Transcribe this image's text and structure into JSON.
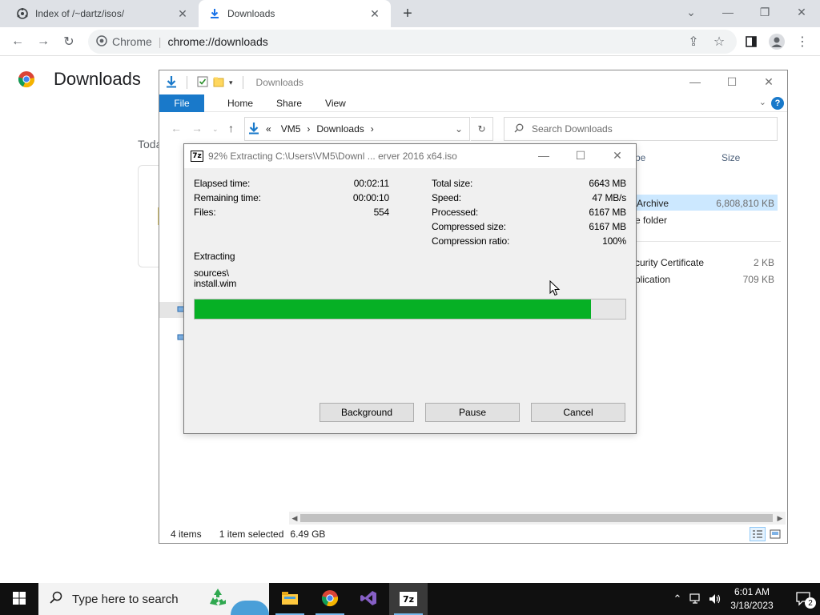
{
  "chrome": {
    "tabs": [
      {
        "label": "Index of /~dartz/isos/",
        "icon": "ubuntu-icon"
      },
      {
        "label": "Downloads",
        "icon": "download-icon"
      }
    ],
    "omnibox": {
      "site": "Chrome",
      "url": "chrome://downloads"
    },
    "page": {
      "title": "Downloads",
      "today_label": "Toda"
    }
  },
  "explorer": {
    "title": "Downloads",
    "ribbon": {
      "file": "File",
      "home": "Home",
      "share": "Share",
      "view": "View"
    },
    "address": {
      "prefix": "«",
      "segments": [
        "VM5",
        "Downloads"
      ]
    },
    "search_placeholder": "Search Downloads",
    "columns": {
      "type_partial": "pe",
      "size": "Size"
    },
    "rows": [
      {
        "type_partial": "Archive",
        "size": "6,808,810 KB",
        "selected": true
      },
      {
        "type_partial": "e folder",
        "size": ""
      },
      {
        "type_partial": "curity Certificate",
        "size": "2 KB"
      },
      {
        "type_partial": "plication",
        "size": "709 KB"
      }
    ],
    "status": {
      "items": "4 items",
      "selected": "1 item selected",
      "size": "6.49 GB"
    }
  },
  "sevenzip": {
    "title": "92% Extracting C:\\Users\\VM5\\Downl ... erver 2016 x64.iso",
    "left_stats": [
      {
        "label": "Elapsed time:",
        "value": "00:02:11"
      },
      {
        "label": "Remaining time:",
        "value": "00:00:10"
      },
      {
        "label": "Files:",
        "value": "554"
      }
    ],
    "right_stats": [
      {
        "label": "Total size:",
        "value": "6643 MB"
      },
      {
        "label": "Speed:",
        "value": "47 MB/s"
      },
      {
        "label": "Processed:",
        "value": "6167 MB"
      },
      {
        "label": "Compressed size:",
        "value": "6167 MB"
      },
      {
        "label": "Compression ratio:",
        "value": "100%"
      }
    ],
    "status_label": "Extracting",
    "path_line1": "sources\\",
    "path_line2": "install.wim",
    "progress_percent": 92,
    "progress_color": "#06b025",
    "buttons": {
      "background": "Background",
      "pause": "Pause",
      "cancel": "Cancel"
    }
  },
  "taskbar": {
    "search_placeholder": "Type here to search",
    "apps": [
      "file-explorer-icon",
      "chrome-icon",
      "visual-studio-icon",
      "7zip-icon"
    ],
    "clock_time": "6:01 AM",
    "clock_date": "3/18/2023",
    "notification_count": "2"
  }
}
